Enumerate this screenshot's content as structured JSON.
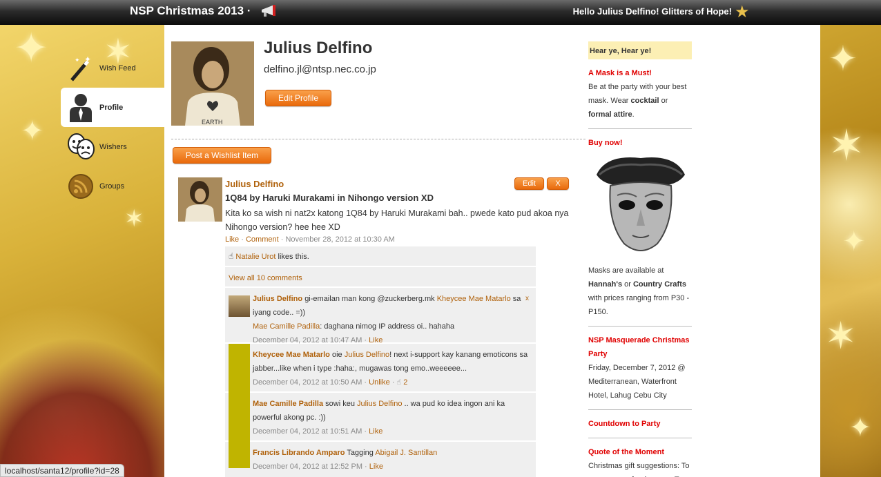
{
  "topbar": {
    "title": "NSP Christmas 2013 ·",
    "greeting": "Hello Julius Delfino! Glitters of Hope!",
    "icons": [
      "megaphone-icon",
      "star-icon"
    ]
  },
  "nav": {
    "items": [
      {
        "label": "Wish Feed",
        "icon": "magic-wand-icon"
      },
      {
        "label": "Profile",
        "icon": "person-icon",
        "active": true
      },
      {
        "label": "Wishers",
        "icon": "theater-masks-icon"
      },
      {
        "label": "Groups",
        "icon": "rss-icon"
      }
    ]
  },
  "profile": {
    "name": "Julius Delfino",
    "email": "delfino.jl@ntsp.nec.co.jp",
    "edit_label": "Edit Profile",
    "shirt_text": "EARTH"
  },
  "post_button": "Post a Wishlist Item",
  "post": {
    "author": "Julius Delfino",
    "title": "1Q84 by Haruki Murakami in Nihongo version XD",
    "body": "Kita ko sa wish ni nat2x katong 1Q84 by Haruki Murakami bah.. pwede kato pud akoa nya Nihongo version? hee hee XD",
    "like": "Like",
    "comment": "Comment",
    "time": "· November 28, 2012 at 10:30 AM",
    "edit_label": "Edit",
    "delete_label": "X",
    "likes_name": "Natalie Urot",
    "likes_suffix": "likes this.",
    "view_all": "View all 10 comments"
  },
  "comments": [
    {
      "author": "Julius Delfino",
      "text1": "gi-emailan man kong @zuckerberg.mk",
      "mention": "Kheycee Mae Matarlo",
      "text2": "sa iyang code.. =))",
      "reply_author": "Mae Camille Padilla",
      "reply_text": ": daghana nimog IP address oi.. hahaha",
      "time": "December 04, 2012 at 10:47 AM ·",
      "action": "Like",
      "close": "x"
    },
    {
      "author": "Kheycee Mae Matarlo",
      "text1": "oie",
      "mention": "Julius Delfino",
      "text2": "! next i-support kay kanang emoticons sa jabber...like when i type :haha:, mugawas tong emo..weeeeee...",
      "time": "December 04, 2012 at 10:50 AM ·",
      "action": "Unlike",
      "count": "2"
    },
    {
      "author": "Mae Camille Padilla",
      "text1": "sowi keu",
      "mention": "Julius Delfino",
      "text2": ".. wa pud ko idea ingon ani ka powerful akong pc. :))",
      "time": "December 04, 2012 at 10:51 AM ·",
      "action": "Like"
    },
    {
      "author": "Francis Librando Amparo",
      "text1": "Tagging",
      "mention": "Abigail J. Santillan",
      "time": "December 04, 2012 at 12:52 PM ·",
      "action": "Like"
    }
  ],
  "sidebar": {
    "heading": "Hear ye, Hear ye!",
    "mask_title": "A Mask is a Must!",
    "mask_text_1": "Be at the party with your best mask. Wear",
    "mask_bold_1": "cocktail",
    "mask_text_2": "or",
    "mask_bold_2": "formal attire",
    "mask_text_3": ".",
    "buy_title": "Buy now!",
    "avail_1": "Masks are available at",
    "avail_bold_1": "Hannah's",
    "avail_2": "or",
    "avail_bold_2": "Country Crafts",
    "avail_3": "with prices ranging from P30 - P150.",
    "party_title": "NSP Masquerade Christmas Party",
    "party_text": "Friday, December 7, 2012 @ Mediterranean, Waterfront Hotel, Lahug Cebu City",
    "countdown_title": "Countdown to Party",
    "quote_title": "Quote of the Moment",
    "quote_text": "Christmas gift suggestions: To your enemy, forgiveness. To"
  },
  "status_url": "localhost/santa12/profile?id=28",
  "colors": {
    "link": "#b0620c",
    "button": "#f08022",
    "sidebar_heading": "#e00000",
    "notice_bg": "#fcefb4"
  }
}
